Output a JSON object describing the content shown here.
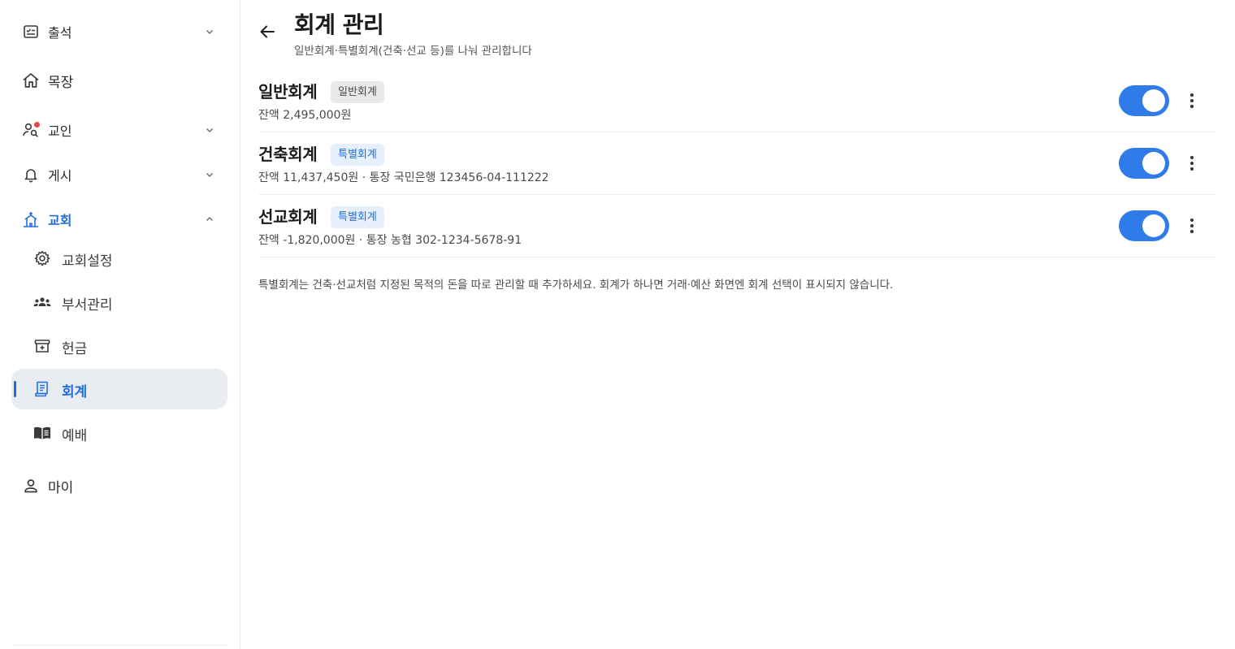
{
  "sidebar": {
    "attendance": {
      "label": "출석"
    },
    "cell": {
      "label": "목장"
    },
    "members": {
      "label": "교인"
    },
    "board": {
      "label": "게시"
    },
    "church": {
      "label": "교회",
      "children": {
        "settings": {
          "label": "교회설정"
        },
        "departments": {
          "label": "부서관리"
        },
        "offering": {
          "label": "헌금"
        },
        "accounting": {
          "label": "회계"
        },
        "worship": {
          "label": "예배"
        }
      }
    },
    "my": {
      "label": "마이"
    }
  },
  "header": {
    "title": "회계 관리",
    "subtitle": "일반회계·특별회계(건축·선교 등)를 나눠 관리합니다"
  },
  "accounts": [
    {
      "name": "일반회계",
      "badge": "일반회계",
      "detail": "잔액 2,495,000원",
      "enabled": true
    },
    {
      "name": "건축회계",
      "badge": "특별회계",
      "detail": "잔액 11,437,450원 · 통장 국민은행 123456-04-111222",
      "enabled": true
    },
    {
      "name": "선교회계",
      "badge": "특별회계",
      "detail": "잔액 -1,820,000원 · 통장 농협 302-1234-5678-91",
      "enabled": true
    }
  ],
  "footnote": "특별회계는 건축·선교처럼 지정된 목적의 돈을 따로 관리할 때 추가하세요. 회계가 하나면 거래·예산 화면엔 회계 선택이 표시되지 않습니다.",
  "colors": {
    "accent": "#1f6fe0",
    "toggle_on": "#2f7bea",
    "special_badge_bg": "#e6f0fd",
    "general_badge_bg": "#e8e9eb",
    "notification_dot": "#e5484d"
  },
  "icons": {
    "attendance": "checklist-icon",
    "cell": "home-icon",
    "members": "person-search-icon",
    "board": "bell-icon",
    "church": "church-icon",
    "settings": "gear-icon",
    "departments": "group-icon",
    "offering": "offering-box-icon",
    "accounting": "ledger-icon",
    "worship": "open-book-icon",
    "my": "person-icon",
    "back": "arrow-left-icon",
    "more": "more-vertical-icon"
  }
}
